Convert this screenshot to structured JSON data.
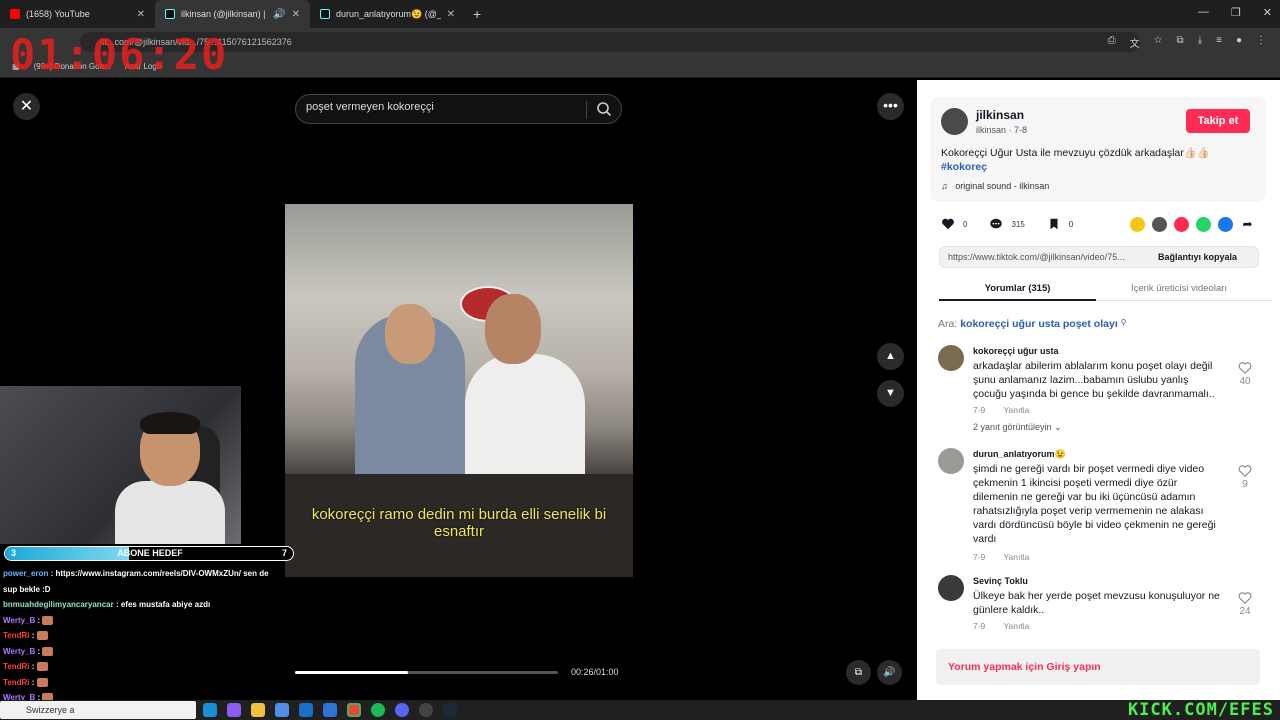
{
  "browser": {
    "tabs": [
      {
        "title": "(1658) YouTube",
        "color": "#ff0000",
        "active": false
      },
      {
        "title": "ilkinsan (@jilkinsan) | TikTok",
        "color": "#111111",
        "active": true
      },
      {
        "title": "durun_anlatıyorum😉 (@_duru",
        "color": "#111111",
        "active": false
      }
    ],
    "url": "kt...com/@jilkinsan/vid.../75...415076121562376",
    "bookmarks": [
      "(99+) Donation Goa...",
      "Azar Logo"
    ]
  },
  "overlay_clock": "01:06:20",
  "video": {
    "search_value": "poşet vermeyen kokoreççi",
    "subtitle": "kokoreççi ramo dedin mi burda elli senelik bi esnaftır",
    "progress_percent": 43,
    "timecode": "00:26/01:00"
  },
  "stream": {
    "goal_left": "3",
    "goal_label": "ABONE HEDEF",
    "goal_right": "7",
    "goal_progress_fraction": 0.43,
    "chat": [
      {
        "user": "power_eron",
        "color": "#6fb4ff",
        "text": ": https://www.instagram.com/reels/DIV-OWMxZUn/ sen de"
      },
      {
        "user": "",
        "color": "#ffffff",
        "text": "sup bekle :D"
      },
      {
        "user": "bnmuahdegilimyancaryancar",
        "color": "#8ce0d0",
        "text": ": efes mustafa abiye azdı"
      },
      {
        "user": "Werty_B",
        "color": "#b874ff",
        "text": ":",
        "emote": true
      },
      {
        "user": "TendRi",
        "color": "#ff3b3b",
        "text": ":",
        "emote": true
      },
      {
        "user": "Werty_B",
        "color": "#b874ff",
        "text": ":",
        "emote": true
      },
      {
        "user": "TendRi",
        "color": "#ff3b3b",
        "text": ":",
        "emote": true
      },
      {
        "user": "TendRi",
        "color": "#ff3b3b",
        "text": ":",
        "emote": true
      },
      {
        "user": "Werty_B",
        "color": "#b874ff",
        "text": ":",
        "emote": true
      }
    ]
  },
  "panel": {
    "username": "jilkinsan",
    "subline": "ilkinsan · 7-8",
    "follow_label": "Takip et",
    "description": "Kokoreççi Uğur Usta ile mevzuyu çözdük arkadaşlar👍🏻👍🏻",
    "hashtag": "#kokoreç",
    "sound": "original sound - ilkinsan",
    "likes": "0",
    "comments_count": "315",
    "saves": "0",
    "link": "https://www.tiktok.com/@jilkinsan/video/75...",
    "copy_label": "Bağlantıyı kopyala",
    "tab_comments": "Yorumlar (315)",
    "tab_creator": "İçerik üreticisi videoları",
    "suggest_prefix": "Ara:",
    "suggest_query": "kokoreççi uğur usta poşet olayı",
    "comments": [
      {
        "name": "kokoreççi uğur usta",
        "text": "arkadaşlar abilerim ablalarım konu poşet olayı değil şunu anlamanız lazim...babamın üslubu yanlış çocuğu yaşında bi gence bu şekilde davranmamalı..",
        "date": "7-9",
        "reply": "Yanıtla",
        "likes": "40",
        "replies": "2 yanıt görüntüleyin"
      },
      {
        "name": "durun_anlatıyorum😉",
        "text": "şimdi ne gereği vardı bir poşet vermedi diye video çekmenin 1 ikincisi poşeti vermedi diye özür dilemenin ne gereği var bu iki üçüncüsü adamın rahatsızlığıyla poşet verip vermemenin ne alakası vardı dördüncüsü böyle bi video çekmenin ne gereği vardı",
        "date": "7-9",
        "reply": "Yanıtla",
        "likes": "9"
      },
      {
        "name": "Sevinç Toklu",
        "text": "Ülkeye bak her yerde poşet mevzusu konuşuluyor ne günlere kaldık..",
        "date": "7-9",
        "reply": "Yanıtla",
        "likes": "24"
      }
    ],
    "login_prompt": "Yorum yapmak için Giriş yapın"
  },
  "taskbar": {
    "search_text": "Swizzerye a",
    "brand": "KICK.COM/EFES"
  }
}
